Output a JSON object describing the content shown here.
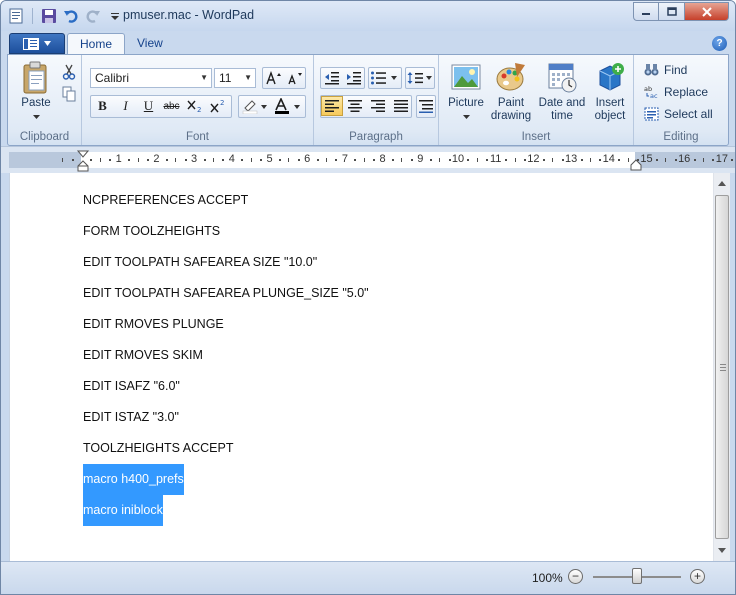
{
  "window": {
    "title": "pmuser.mac - WordPad"
  },
  "quick_access": {
    "items": [
      "app-icon",
      "save-icon",
      "undo-icon",
      "redo-icon",
      "customize-dropdown-icon"
    ]
  },
  "tabs": [
    {
      "label": "Home",
      "active": true
    },
    {
      "label": "View",
      "active": false
    }
  ],
  "ribbon": {
    "clipboard": {
      "label": "Clipboard",
      "paste_label": "Paste"
    },
    "font": {
      "label": "Font",
      "family": "Calibri",
      "size": "11"
    },
    "paragraph": {
      "label": "Paragraph"
    },
    "insert": {
      "label": "Insert",
      "picture_label": "Picture",
      "paint_label_1": "Paint",
      "paint_label_2": "drawing",
      "datetime_label_1": "Date and",
      "datetime_label_2": "time",
      "object_label_1": "Insert",
      "object_label_2": "object"
    },
    "editing": {
      "label": "Editing",
      "find_label": "Find",
      "replace_label": "Replace",
      "selectall_label": "Select all"
    }
  },
  "ruler": {
    "numbers": [
      "1",
      "2",
      "3",
      "4",
      "5",
      "6",
      "7",
      "8",
      "9",
      "10",
      "11",
      "12",
      "13",
      "14",
      "15",
      "16",
      "17"
    ]
  },
  "document": {
    "lines": [
      {
        "text": "NCPREFERENCES ACCEPT",
        "selected": false
      },
      {
        "text": "FORM TOOLZHEIGHTS",
        "selected": false
      },
      {
        "text": "EDIT TOOLPATH SAFEAREA SIZE \"10.0\"",
        "selected": false
      },
      {
        "text": "EDIT TOOLPATH SAFEAREA PLUNGE_SIZE \"5.0\"",
        "selected": false
      },
      {
        "text": "EDIT RMOVES PLUNGE",
        "selected": false
      },
      {
        "text": "EDIT RMOVES SKIM",
        "selected": false
      },
      {
        "text": "EDIT ISAFZ \"6.0\"",
        "selected": false
      },
      {
        "text": "EDIT ISTAZ \"3.0\"",
        "selected": false
      },
      {
        "text": "TOOLZHEIGHTS ACCEPT",
        "selected": false
      },
      {
        "text": "macro h400_prefs",
        "selected": true
      },
      {
        "text": "macro iniblock",
        "selected": true
      }
    ]
  },
  "statusbar": {
    "zoom": "100%",
    "zoom_minus": "−",
    "zoom_plus": "+",
    "zoom_level_fraction": 0.5
  }
}
